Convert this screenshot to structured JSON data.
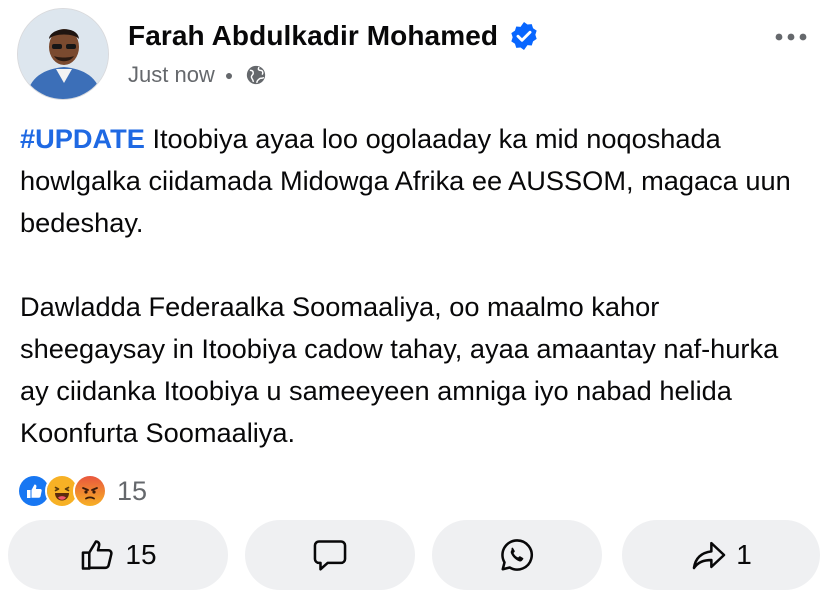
{
  "post": {
    "author": "Farah Abdulkadir Mohamed",
    "timestamp": "Just now",
    "audience_icon": "globe-icon",
    "hashtag": "#UPDATE",
    "paragraph1_rest": " Itoobiya ayaa loo ogolaaday ka mid noqoshada howlgalka ciidamada Midowga Afrika ee AUSSOM, magaca uun bedeshay.",
    "paragraph2": "Dawladda Federaalka Soomaaliya, oo maalmo kahor sheegaysay in Itoobiya cadow tahay, ayaa amaantay naf-hurka ay ciidanka Itoobiya u sameeyeen amniga iyo nabad helida Koonfurta Soomaaliya."
  },
  "reactions": {
    "icons": [
      "like-icon",
      "haha-icon",
      "angry-icon"
    ],
    "count": "15"
  },
  "actions": {
    "like_count": "15",
    "share_count": "1"
  },
  "colors": {
    "accent": "#1f69e3",
    "verified": "#0866ff",
    "muted": "#65686c",
    "button_bg": "#eff0f2"
  }
}
